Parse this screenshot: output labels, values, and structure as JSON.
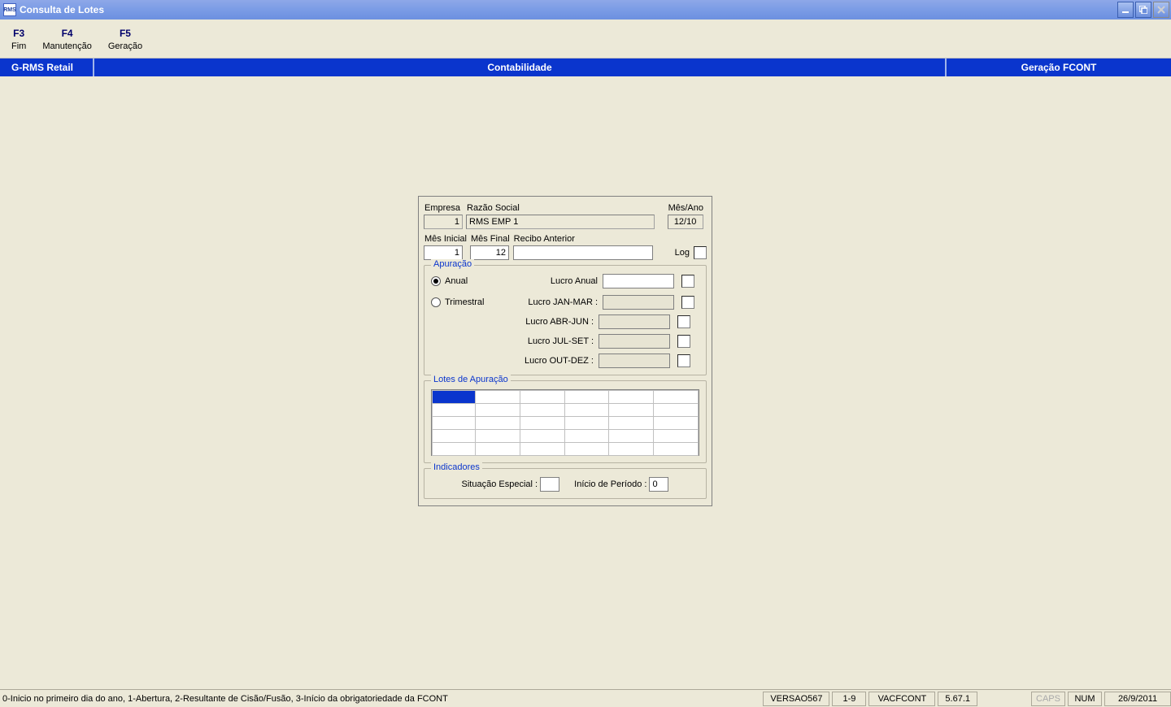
{
  "title": "Consulta de Lotes",
  "app_icon": "RMS",
  "menu": [
    {
      "key": "F3",
      "label": "Fim"
    },
    {
      "key": "F4",
      "label": "Manutenção"
    },
    {
      "key": "F5",
      "label": "Geração"
    }
  ],
  "infobar": {
    "left": "G-RMS Retail",
    "mid": "Contabilidade",
    "right": "Geração FCONT"
  },
  "form": {
    "labels": {
      "empresa": "Empresa",
      "razao": "Razão Social",
      "mesano": "Mês/Ano",
      "mesini": "Mês Inicial",
      "mesfim": "Mês Final",
      "recibo": "Recibo Anterior",
      "log": "Log",
      "apuracao": "Apuração",
      "anual": "Anual",
      "trimestral": "Trimestral",
      "lucro_anual": "Lucro Anual",
      "lucro_jm": "Lucro JAN-MAR :",
      "lucro_aj": "Lucro ABR-JUN :",
      "lucro_js": "Lucro JUL-SET :",
      "lucro_od": "Lucro OUT-DEZ :",
      "lotes": "Lotes de Apuração",
      "indic": "Indicadores",
      "sit_esp": "Situação Especial :",
      "ini_per": "Início de Período :"
    },
    "values": {
      "empresa": "1",
      "razao": "RMS EMP 1",
      "mesano": "12/10",
      "mesini": "1",
      "mesfim": "12",
      "recibo": "",
      "lucro_anual": "",
      "lucro_jm": "",
      "lucro_aj": "",
      "lucro_js": "",
      "lucro_od": "",
      "sit_esp": "",
      "ini_per": "0"
    }
  },
  "status": {
    "msg": "0-Inicio no primeiro dia do ano, 1-Abertura, 2-Resultante de Cisão/Fusão, 3-Início da obrigatoriedade da FCONT",
    "versao": "VERSAO567",
    "range": "1-9",
    "prog": "VACFCONT",
    "ver": "5.67.1",
    "caps": "CAPS",
    "num": "NUM",
    "date": "26/9/2011"
  }
}
